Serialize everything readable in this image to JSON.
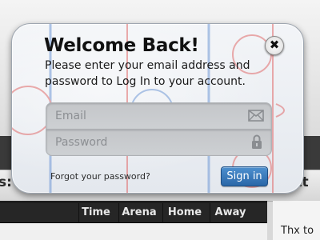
{
  "background": {
    "left_heading": "s:",
    "right_heading": "ftt",
    "table_columns": [
      "Time",
      "Arena",
      "Home",
      "Away"
    ],
    "right_text": "Thx to"
  },
  "modal": {
    "title": "Welcome Back!",
    "message": "Please enter your email address and password to Log In to your account.",
    "close_icon": "close-icon",
    "email": {
      "placeholder": "Email",
      "value": "",
      "icon": "envelope-icon"
    },
    "password": {
      "placeholder": "Password",
      "value": "",
      "icon": "lock-icon"
    },
    "forgot_link": "Forgot your password?",
    "signin_label": "Sign in",
    "accent_color": "#2f6fb0",
    "rink_red": "#e06a6a",
    "rink_blue": "#6f98d6"
  }
}
